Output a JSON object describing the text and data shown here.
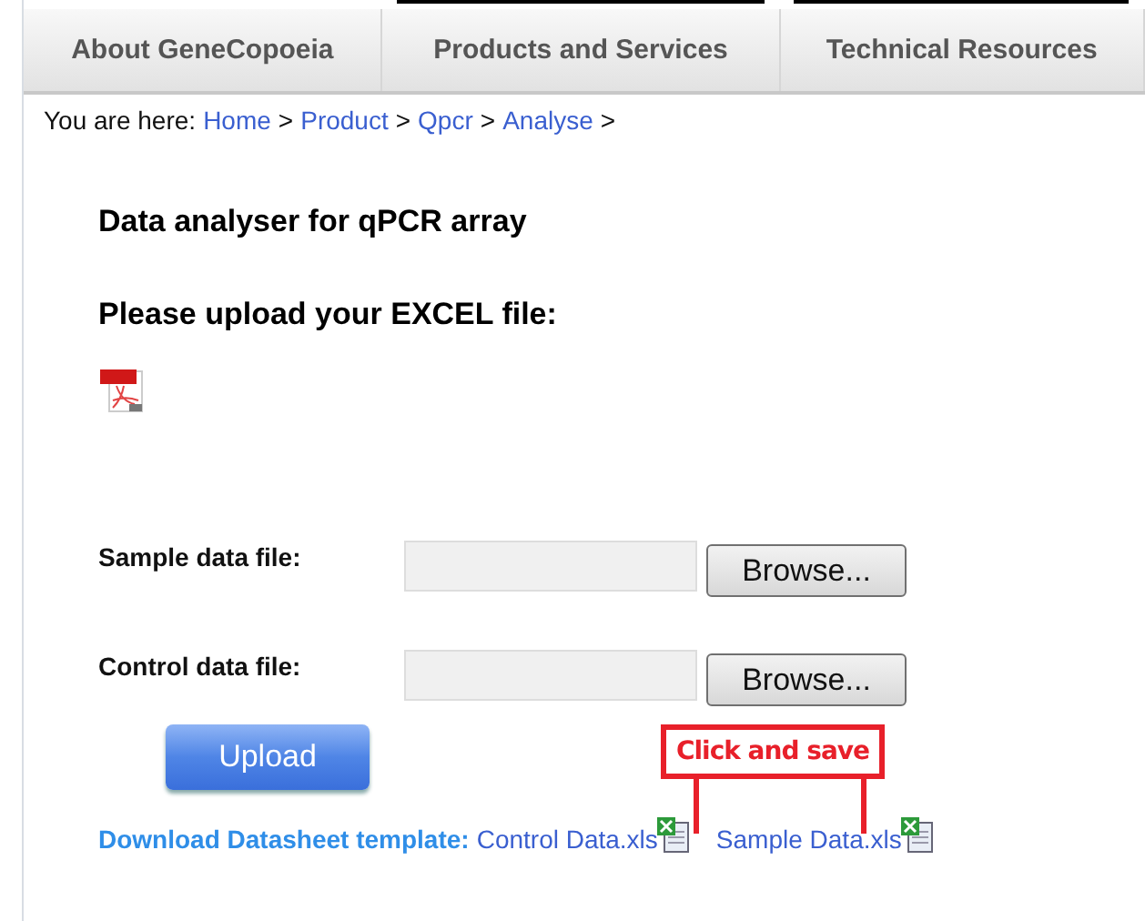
{
  "nav": {
    "tabs": [
      {
        "label": "About GeneCopoeia",
        "selected": false
      },
      {
        "label": "Products and Services",
        "selected": true
      },
      {
        "label": "Technical Resources",
        "selected": true
      }
    ]
  },
  "breadcrumb": {
    "prefix": "You are here:",
    "links": [
      "Home",
      "Product",
      "Qpcr",
      "Analyse"
    ],
    "separator": ">"
  },
  "title": "Data analyser for qPCR array",
  "subtitle": "Please upload your EXCEL file:",
  "file_fields": [
    {
      "label": "Sample data file:",
      "button": "Browse..."
    },
    {
      "label": "Control data file:",
      "button": "Browse..."
    }
  ],
  "upload_button": "Upload",
  "callout": "Click and save",
  "download": {
    "label": "Download Datasheet template:",
    "files": [
      "Control Data.xls",
      "Sample Data.xls"
    ]
  }
}
